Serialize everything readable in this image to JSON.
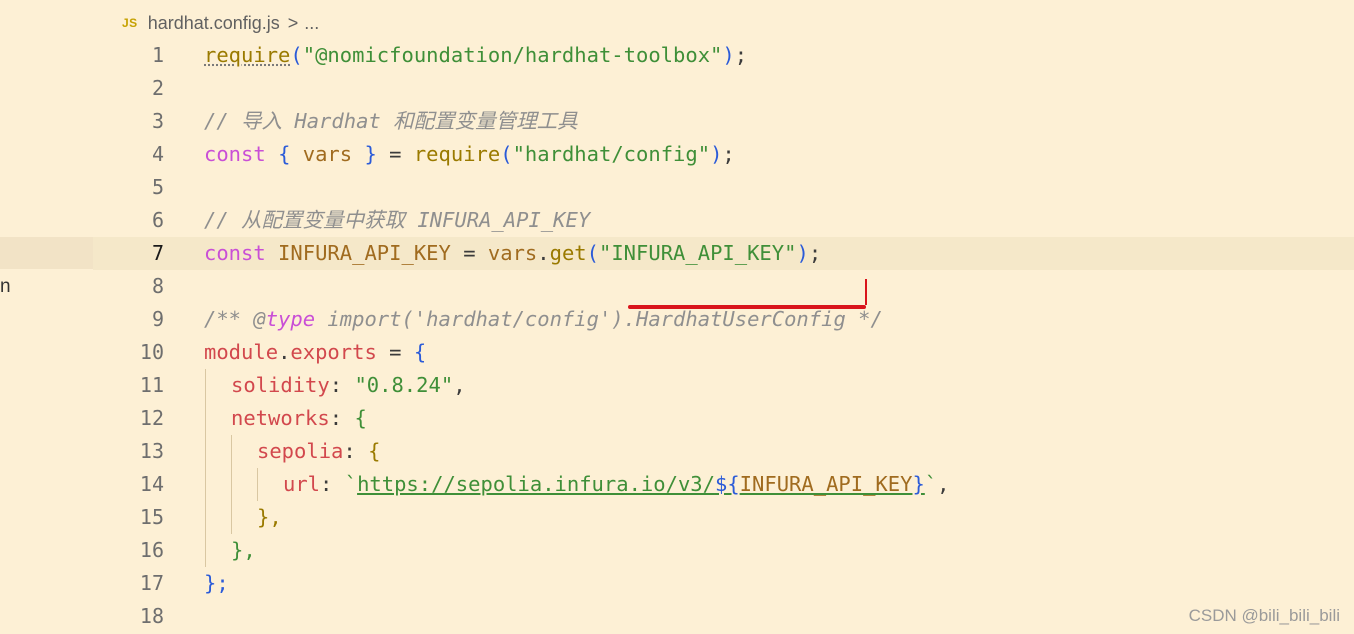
{
  "breadcrumb": {
    "file_icon": "JS",
    "file_name": "hardhat.config.js",
    "separator": ">",
    "ellipsis": "..."
  },
  "left_panel": {
    "fragment_text": "n"
  },
  "editor": {
    "current_line": 7,
    "lines": [
      {
        "n": "1"
      },
      {
        "n": "2"
      },
      {
        "n": "3"
      },
      {
        "n": "4"
      },
      {
        "n": "5"
      },
      {
        "n": "6"
      },
      {
        "n": "7"
      },
      {
        "n": "8"
      },
      {
        "n": "9"
      },
      {
        "n": "10"
      },
      {
        "n": "11"
      },
      {
        "n": "12"
      },
      {
        "n": "13"
      },
      {
        "n": "14"
      },
      {
        "n": "15"
      },
      {
        "n": "16"
      },
      {
        "n": "17"
      },
      {
        "n": "18"
      }
    ],
    "tokens": {
      "l1_require": "require",
      "l1_open": "(",
      "l1_str": "\"@nomicfoundation/hardhat-toolbox\"",
      "l1_close": ")",
      "l1_semi": ";",
      "l3_comment": "// 导入 Hardhat 和配置变量管理工具",
      "l4_const": "const",
      "l4_lbrace": "{",
      "l4_vars": " vars ",
      "l4_rbrace": "}",
      "l4_eq": " = ",
      "l4_require": "require",
      "l4_open": "(",
      "l4_str": "\"hardhat/config\"",
      "l4_close": ")",
      "l4_semi": ";",
      "l6_comment": "// 从配置变量中获取 INFURA_API_KEY",
      "l7_const": "const",
      "l7_name": " INFURA_API_KEY",
      "l7_eq": " = ",
      "l7_vars": "vars",
      "l7_dot": ".",
      "l7_get": "get",
      "l7_open": "(",
      "l7_str": "\"INFURA_API_KEY\"",
      "l7_close": ")",
      "l7_semi": ";",
      "l9_c1": "/** @",
      "l9_type": "type",
      "l9_c2": " import('hardhat/config').HardhatUserConfig */",
      "l10_module": "module",
      "l10_dot": ".",
      "l10_exports": "exports",
      "l10_eq": " = ",
      "l10_brace": "{",
      "l11_key": "solidity",
      "l11_colon": ": ",
      "l11_val": "\"0.8.24\"",
      "l11_comma": ",",
      "l12_key": "networks",
      "l12_colon": ": ",
      "l12_brace": "{",
      "l13_key": "sepolia",
      "l13_colon": ": ",
      "l13_brace": "{",
      "l14_key": "url",
      "l14_colon": ": ",
      "l14_tick_open": "`",
      "l14_url": "https://sepolia.infura.io/v3/",
      "l14_tpl_open": "${",
      "l14_tpl_var": "INFURA_API_KEY",
      "l14_tpl_close": "}",
      "l14_tick_close": "`",
      "l14_comma": ",",
      "l15_close": "},",
      "l16_close": "},",
      "l17_close": "};"
    }
  },
  "watermark": "CSDN @bili_bili_bili",
  "colors": {
    "background": "#fdf0d5",
    "keyword": "#c94fd6",
    "function": "#9a7a00",
    "string": "#3f8f38",
    "comment": "#8f8f8f",
    "property": "#d2484d",
    "annotation_red": "#d9141b"
  }
}
